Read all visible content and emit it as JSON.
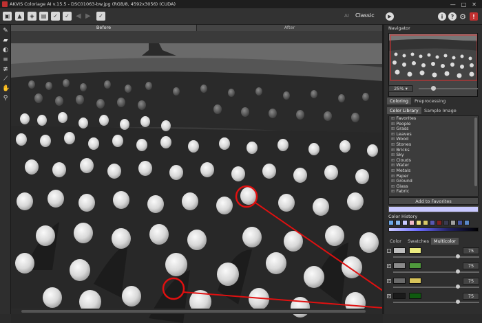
{
  "window": {
    "title": "AKVIS Coloriage AI v.15.5 - DSC01063-bw.jpg (RGB/8, 4592x3056) (CUDA)",
    "controls": [
      "—",
      "□",
      "✕"
    ]
  },
  "toolbar": {
    "mode_ai": "AI",
    "mode_classic": "Classic"
  },
  "canvas": {
    "tab_before": "Before",
    "tab_after": "After"
  },
  "navigator": {
    "title": "Navigator",
    "zoom": "25% ▾"
  },
  "panel_tabs": {
    "coloring": "Coloring",
    "preprocessing": "Preprocessing"
  },
  "library_tabs": {
    "color_library": "Color Library",
    "sample_image": "Sample Image"
  },
  "library": {
    "items": [
      "Favorites",
      "People",
      "Grass",
      "Leaves",
      "Wood",
      "Stones",
      "Bricks",
      "Sky",
      "Clouds",
      "Water",
      "Metals",
      "Paper",
      "Ground",
      "Glass",
      "Fabric"
    ],
    "add_to_favorites": "Add to Favorites",
    "current_color": "#c9c9ff"
  },
  "color_history": {
    "title": "Color History",
    "swatches": [
      "#6aa6e6",
      "#88b8ee",
      "#c9c9ff",
      "#f0b8c8",
      "#f0e080",
      "#d8c868",
      "#5858b0",
      "#802020",
      "#3a3a50",
      "#a0a0a0",
      "#4858a8",
      "#5a88c8"
    ]
  },
  "bottom_tabs": {
    "color": "Color",
    "swatches": "Swatches",
    "multicolor": "Multicolor"
  },
  "multicolor": {
    "rows": [
      {
        "checked": "",
        "src": "#bdbdbd",
        "dst": "#ecec80",
        "value": "75"
      },
      {
        "checked": "✓",
        "src": "#8a8a8a",
        "dst": "#4f9a3c",
        "value": "75"
      },
      {
        "checked": "✓",
        "src": "#6a6a6a",
        "dst": "#d8c45a",
        "value": "75"
      },
      {
        "checked": "✓",
        "src": "#1a1a1a",
        "dst": "#0f5a0f",
        "value": "75"
      }
    ]
  }
}
